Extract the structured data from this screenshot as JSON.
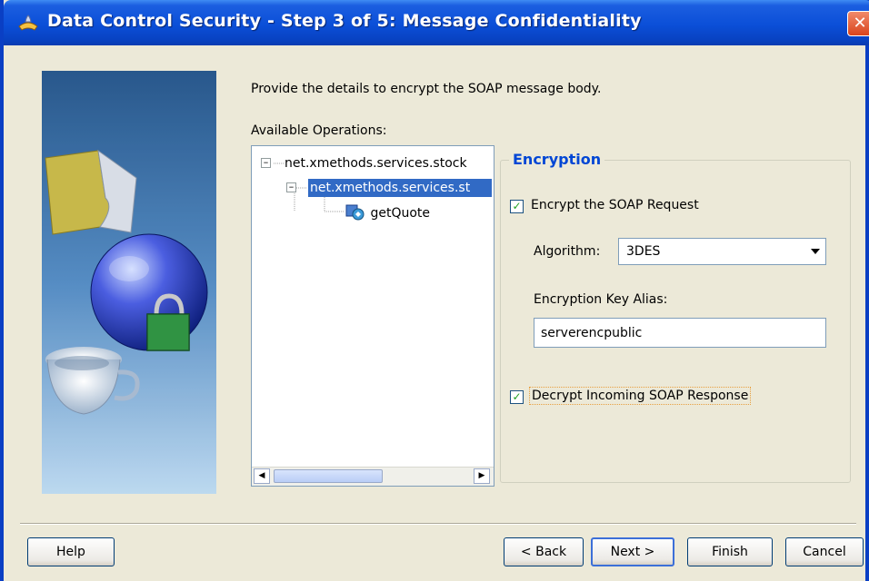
{
  "window": {
    "title": "Data Control Security - Step 3 of 5: Message Confidentiality",
    "close_glyph": "✕"
  },
  "intro_text": "Provide the details to encrypt the SOAP message body.",
  "available_operations": {
    "label": "Available Operations:",
    "tree": [
      {
        "label": "net.xmethods.services.stock"
      },
      {
        "label": "net.xmethods.services.st"
      },
      {
        "label": "getQuote"
      }
    ]
  },
  "encryption": {
    "legend": "Encryption",
    "encrypt_request": {
      "label": "Encrypt the SOAP Request",
      "checked": true
    },
    "algorithm": {
      "label": "Algorithm:",
      "value": "3DES"
    },
    "key_alias": {
      "label": "Encryption Key Alias:",
      "value": "serverencpublic"
    },
    "decrypt_response": {
      "label": "Decrypt Incoming SOAP Response",
      "checked": true
    }
  },
  "buttons": {
    "help": "Help",
    "back": "< Back",
    "next": "Next >",
    "finish": "Finish",
    "cancel": "Cancel"
  },
  "colors": {
    "titlebar": "#0b4fd8",
    "selection": "#316ac5",
    "legend": "#0046d5",
    "background": "#ece9d8"
  }
}
